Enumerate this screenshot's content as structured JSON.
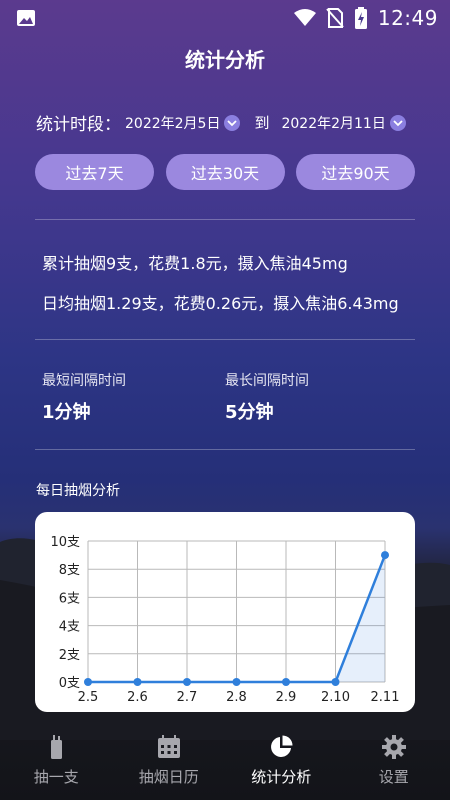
{
  "statusbar": {
    "time": "12:49"
  },
  "header": {
    "title": "统计分析"
  },
  "period": {
    "label": "统计时段：",
    "start": "2022年2月5日",
    "to": "到",
    "end": "2022年2月11日"
  },
  "ranges": [
    "过去7天",
    "过去30天",
    "过去90天"
  ],
  "summary": {
    "total": "累计抽烟9支，花费1.8元，摄入焦油45mg",
    "daily_avg": "日均抽烟1.29支，花费0.26元，摄入焦油6.43mg"
  },
  "intervals": {
    "shortest_label": "最短间隔时间",
    "shortest_value": "1分钟",
    "longest_label": "最长间隔时间",
    "longest_value": "5分钟"
  },
  "daily_section": {
    "title": "每日抽烟分析"
  },
  "chart_data": {
    "type": "line",
    "title": "",
    "xlabel": "",
    "ylabel": "",
    "categories": [
      "2.5",
      "2.6",
      "2.7",
      "2.8",
      "2.9",
      "2.10",
      "2.11"
    ],
    "series": [
      {
        "values": [
          0,
          0,
          0,
          0,
          0,
          0,
          9
        ]
      }
    ],
    "ylim": [
      0,
      10
    ],
    "ytick_labels": [
      "0支",
      "2支",
      "4支",
      "6支",
      "8支",
      "10支"
    ],
    "grid": true,
    "line_color": "#2f7fdb"
  },
  "tabbar": {
    "tabs": [
      {
        "label": "抽一支",
        "icon": "cigarette-icon"
      },
      {
        "label": "抽烟日历",
        "icon": "calendar-icon"
      },
      {
        "label": "统计分析",
        "icon": "pie-chart-icon"
      },
      {
        "label": "设置",
        "icon": "gear-icon"
      }
    ],
    "active_index": 2
  },
  "colors": {
    "accent": "#9b88df",
    "dropdown": "#8b7fe0",
    "line": "#2f7fdb"
  }
}
